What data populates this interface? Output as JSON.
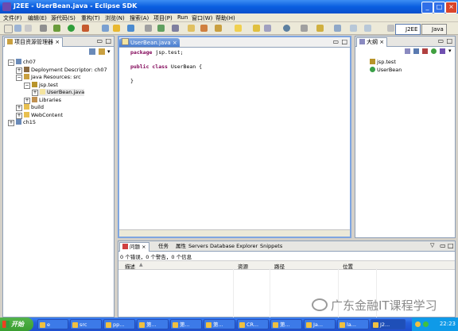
{
  "window": {
    "title": "J2EE - UserBean.java - Eclipse SDK",
    "controls": [
      "_",
      "□",
      "×"
    ]
  },
  "menu": [
    "文件(F)",
    "编辑(E)",
    "源代码(S)",
    "重构(T)",
    "浏览(N)",
    "搜索(A)",
    "项目(P)",
    "Run",
    "窗口(W)",
    "帮助(H)"
  ],
  "toolbar": {
    "perspectives": [
      "J2EE",
      "Java"
    ]
  },
  "left_view": {
    "tab_label": "项目资源管理器",
    "tree": [
      {
        "label": "ch07",
        "level": 0,
        "expander": "−",
        "icon": "project-icon"
      },
      {
        "label": "Deployment Descriptor: ch07",
        "level": 1,
        "expander": "+",
        "icon": "descriptor-icon"
      },
      {
        "label": "Java Resources: src",
        "level": 1,
        "expander": "−",
        "icon": "source-folder-icon"
      },
      {
        "label": "jsp.test",
        "level": 2,
        "expander": "−",
        "icon": "package-icon"
      },
      {
        "label": "UserBean.java",
        "level": 3,
        "expander": "+",
        "icon": "java-file-icon",
        "selected": true
      },
      {
        "label": "Libraries",
        "level": 2,
        "expander": "+",
        "icon": "library-icon"
      },
      {
        "label": "build",
        "level": 1,
        "expander": "+",
        "icon": "folder-icon"
      },
      {
        "label": "WebContent",
        "level": 1,
        "expander": "+",
        "icon": "folder-icon"
      },
      {
        "label": "ch15",
        "level": 0,
        "expander": "+",
        "icon": "project-icon"
      }
    ]
  },
  "editor": {
    "tab_label": "UserBean.java",
    "lines": [
      {
        "kw": "package",
        "rest": " jsp.test;"
      },
      {
        "kw": "",
        "rest": ""
      },
      {
        "kw": "public class",
        "rest": " UserBean {"
      },
      {
        "kw": "",
        "rest": ""
      },
      {
        "kw": "",
        "rest": "}"
      }
    ]
  },
  "outline": {
    "tab_label": "大纲",
    "items": [
      {
        "label": "jsp.test",
        "icon": "package-icon"
      },
      {
        "label": "UserBean",
        "icon": "class-icon"
      }
    ]
  },
  "bottom": {
    "tabs": [
      "问题",
      "任务",
      "属性",
      "Servers",
      "Database Explorer",
      "Snippets"
    ],
    "summary": "0 个错误，0 个警告，0 个信息",
    "columns": [
      "描述",
      "资源",
      "路径",
      "位置"
    ]
  },
  "taskbar": {
    "start": "开始",
    "items": [
      "e",
      "src",
      "pp...",
      "第...",
      "第...",
      "第...",
      "CR...",
      "第...",
      "Ja...",
      "la...",
      "J2..."
    ],
    "time": "22:23"
  },
  "watermark": "广东金融IT课程学习",
  "colors": {
    "title": "#0a5ee0",
    "keyword": "#7f0055",
    "panel_border": "#8ea0b8",
    "taskbar": "#245edb",
    "start": "#3a9d31"
  }
}
